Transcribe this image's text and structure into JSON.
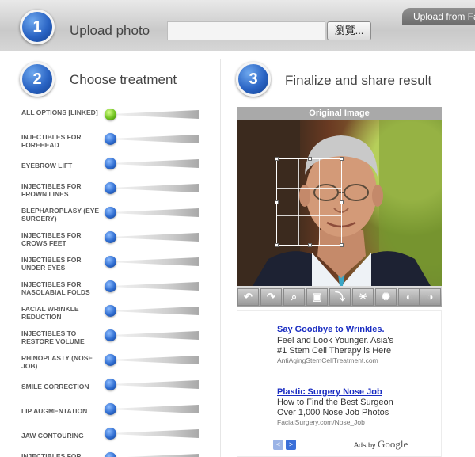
{
  "header": {
    "tab_label": "Upload from Facebook",
    "step1_number": "1",
    "step1_title": "Upload photo",
    "browse_label": "瀏覽...",
    "file_value": ""
  },
  "treatments": {
    "step_number": "2",
    "title": "Choose treatment",
    "items": [
      {
        "label": "ALL OPTIONS [LINKED]",
        "active": true
      },
      {
        "label": "INJECTIBLES FOR FOREHEAD"
      },
      {
        "label": "EYEBROW LIFT"
      },
      {
        "label": "INJECTIBLES FOR FROWN LINES"
      },
      {
        "label": "BLEPHAROPLASY (EYE SURGERY)"
      },
      {
        "label": "INJECTIBLES FOR CROWS FEET"
      },
      {
        "label": "INJECTIBLES FOR UNDER EYES"
      },
      {
        "label": "INJECTIBLES FOR NASOLABIAL FOLDS"
      },
      {
        "label": "FACIAL WRINKLE REDUCTION"
      },
      {
        "label": "INJECTIBLES TO RESTORE VOLUME"
      },
      {
        "label": "RHINOPLASTY (NOSE JOB)"
      },
      {
        "label": "SMILE CORRECTION"
      },
      {
        "label": "LIP AUGMENTATION"
      },
      {
        "label": "JAW CONTOURING"
      },
      {
        "label": "INJECTIBLES FOR UNDER THE LIPS"
      }
    ]
  },
  "result": {
    "step_number": "3",
    "title": "Finalize and share result",
    "image_header": "Original Image",
    "tools": [
      "undo-icon",
      "redo-icon",
      "zoom-icon",
      "crop-icon",
      "rotate-icon",
      "brightness-down-icon",
      "brightness-up-icon",
      "contrast-plus-icon",
      "contrast-minus-icon"
    ]
  },
  "ads": {
    "ad1": {
      "title": "Say Goodbye to Wrinkles.",
      "line1": "Feel and Look Younger. Asia's",
      "line2": "#1 Stem Cell Therapy is Here",
      "url": "AntiAgingStemCellTreatment.com"
    },
    "ad2": {
      "title": "Plastic Surgery Nose Job",
      "line1": "How to Find the Best Surgeon",
      "line2": "Over 1,000 Nose Job Photos",
      "url": "FacialSurgery.com/Nose_Job"
    },
    "ads_by": "Ads by",
    "google": "Google",
    "prev": "<",
    "next": ">"
  },
  "colors": {
    "accent_blue": "#2a64c4",
    "active_green": "#6fc21f",
    "ad_link": "#1a2dc2"
  }
}
